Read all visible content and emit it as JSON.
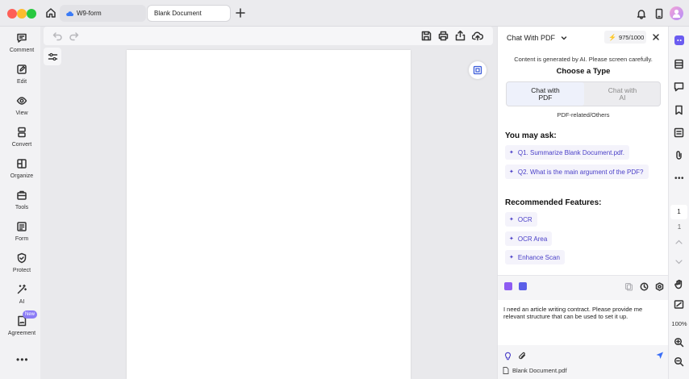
{
  "tabs": [
    {
      "label": "W9-form"
    },
    {
      "label": "Blank Document"
    }
  ],
  "left_nav": [
    {
      "label": "Comment",
      "icon": "comment-icon"
    },
    {
      "label": "Edit",
      "icon": "edit-icon"
    },
    {
      "label": "View",
      "icon": "view-icon"
    },
    {
      "label": "Convert",
      "icon": "convert-icon"
    },
    {
      "label": "Organize",
      "icon": "organize-icon"
    },
    {
      "label": "Tools",
      "icon": "tools-icon"
    },
    {
      "label": "Form",
      "icon": "form-icon"
    },
    {
      "label": "Protect",
      "icon": "shield-icon"
    },
    {
      "label": "AI",
      "icon": "ai-wand-icon"
    },
    {
      "label": "Agreement",
      "icon": "agreement-icon",
      "badge": "New"
    }
  ],
  "chat": {
    "title": "Chat With PDF",
    "credits": "975/1000",
    "notice": "Content is generated by AI. Please screen carefully.",
    "choose_type": "Choose a Type",
    "type_options": [
      {
        "line1": "Chat with",
        "line2": "PDF",
        "selected": true
      },
      {
        "line1": "Chat with",
        "line2": "AI",
        "selected": false
      }
    ],
    "scope": "PDF-related/Others",
    "ask_heading": "You may ask:",
    "questions": [
      "Q1. Summarize Blank Document.pdf.",
      "Q2. What is the main argument of the PDF?"
    ],
    "features_heading": "Recommended Features:",
    "features": [
      "OCR",
      "OCR Area",
      "Enhance Scan"
    ],
    "input_text": "I need an article writing contract. Please provide me relevant structure that can be used to set it up.",
    "attachment": "Blank Document.pdf"
  },
  "right_rail": {
    "page_current": "1",
    "page_total": "1",
    "zoom": "100%"
  },
  "colors": {
    "accent": "#4b40c8",
    "chip_bg": "#f4f3fb",
    "badge": "#8b7cf6"
  }
}
